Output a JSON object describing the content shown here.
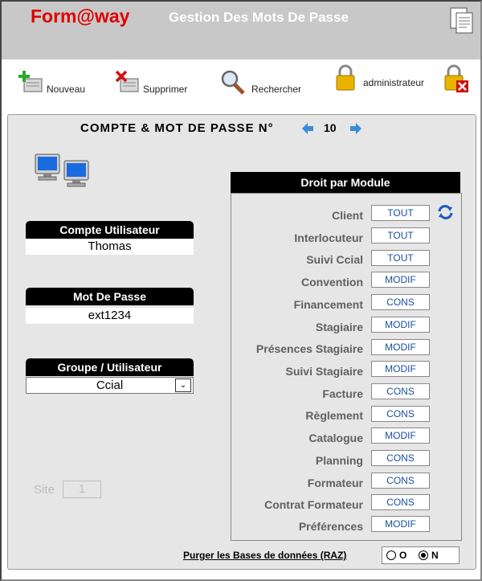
{
  "header": {
    "logo": "Form@way",
    "title": "Gestion Des Mots De Passe"
  },
  "toolbar": {
    "new_label": "Nouveau",
    "delete_label": "Supprimer",
    "search_label": "Rechercher",
    "admin_label": "administrateur"
  },
  "record": {
    "title": "COMPTE & MOT DE PASSE N°",
    "number": "10"
  },
  "account": {
    "user_label": "Compte Utilisateur",
    "user_value": "Thomas",
    "password_label": "Mot De Passe",
    "password_value": "ext1234",
    "group_label": "Groupe / Utilisateur",
    "group_value": "Ccial",
    "site_label": "Site",
    "site_value": "1"
  },
  "rights": {
    "header": "Droit par Module",
    "rows": [
      {
        "module": "Client",
        "right": "TOUT"
      },
      {
        "module": "Interlocuteur",
        "right": "TOUT"
      },
      {
        "module": "Suivi Ccial",
        "right": "TOUT"
      },
      {
        "module": "Convention",
        "right": "MODIF"
      },
      {
        "module": "Financement",
        "right": "CONS"
      },
      {
        "module": "Stagiaire",
        "right": "MODIF"
      },
      {
        "module": "Présences Stagiaire",
        "right": "MODIF"
      },
      {
        "module": "Suivi Stagiaire",
        "right": "MODIF"
      },
      {
        "module": "Facture",
        "right": "CONS"
      },
      {
        "module": "Règlement",
        "right": "CONS"
      },
      {
        "module": "Catalogue",
        "right": "MODIF"
      },
      {
        "module": "Planning",
        "right": "CONS"
      },
      {
        "module": "Formateur",
        "right": "CONS"
      },
      {
        "module": "Contrat Formateur",
        "right": "CONS"
      },
      {
        "module": "Préférences",
        "right": "MODIF"
      }
    ]
  },
  "purge": {
    "label": "Purger les Bases de données (RAZ)",
    "option_yes": "O",
    "option_no": "N",
    "selected": "N"
  },
  "colors": {
    "logo": "#e00000",
    "header_bg": "#c8c8c8",
    "panel_bg": "#e6e6e6",
    "button_text": "#1a4fa0"
  }
}
